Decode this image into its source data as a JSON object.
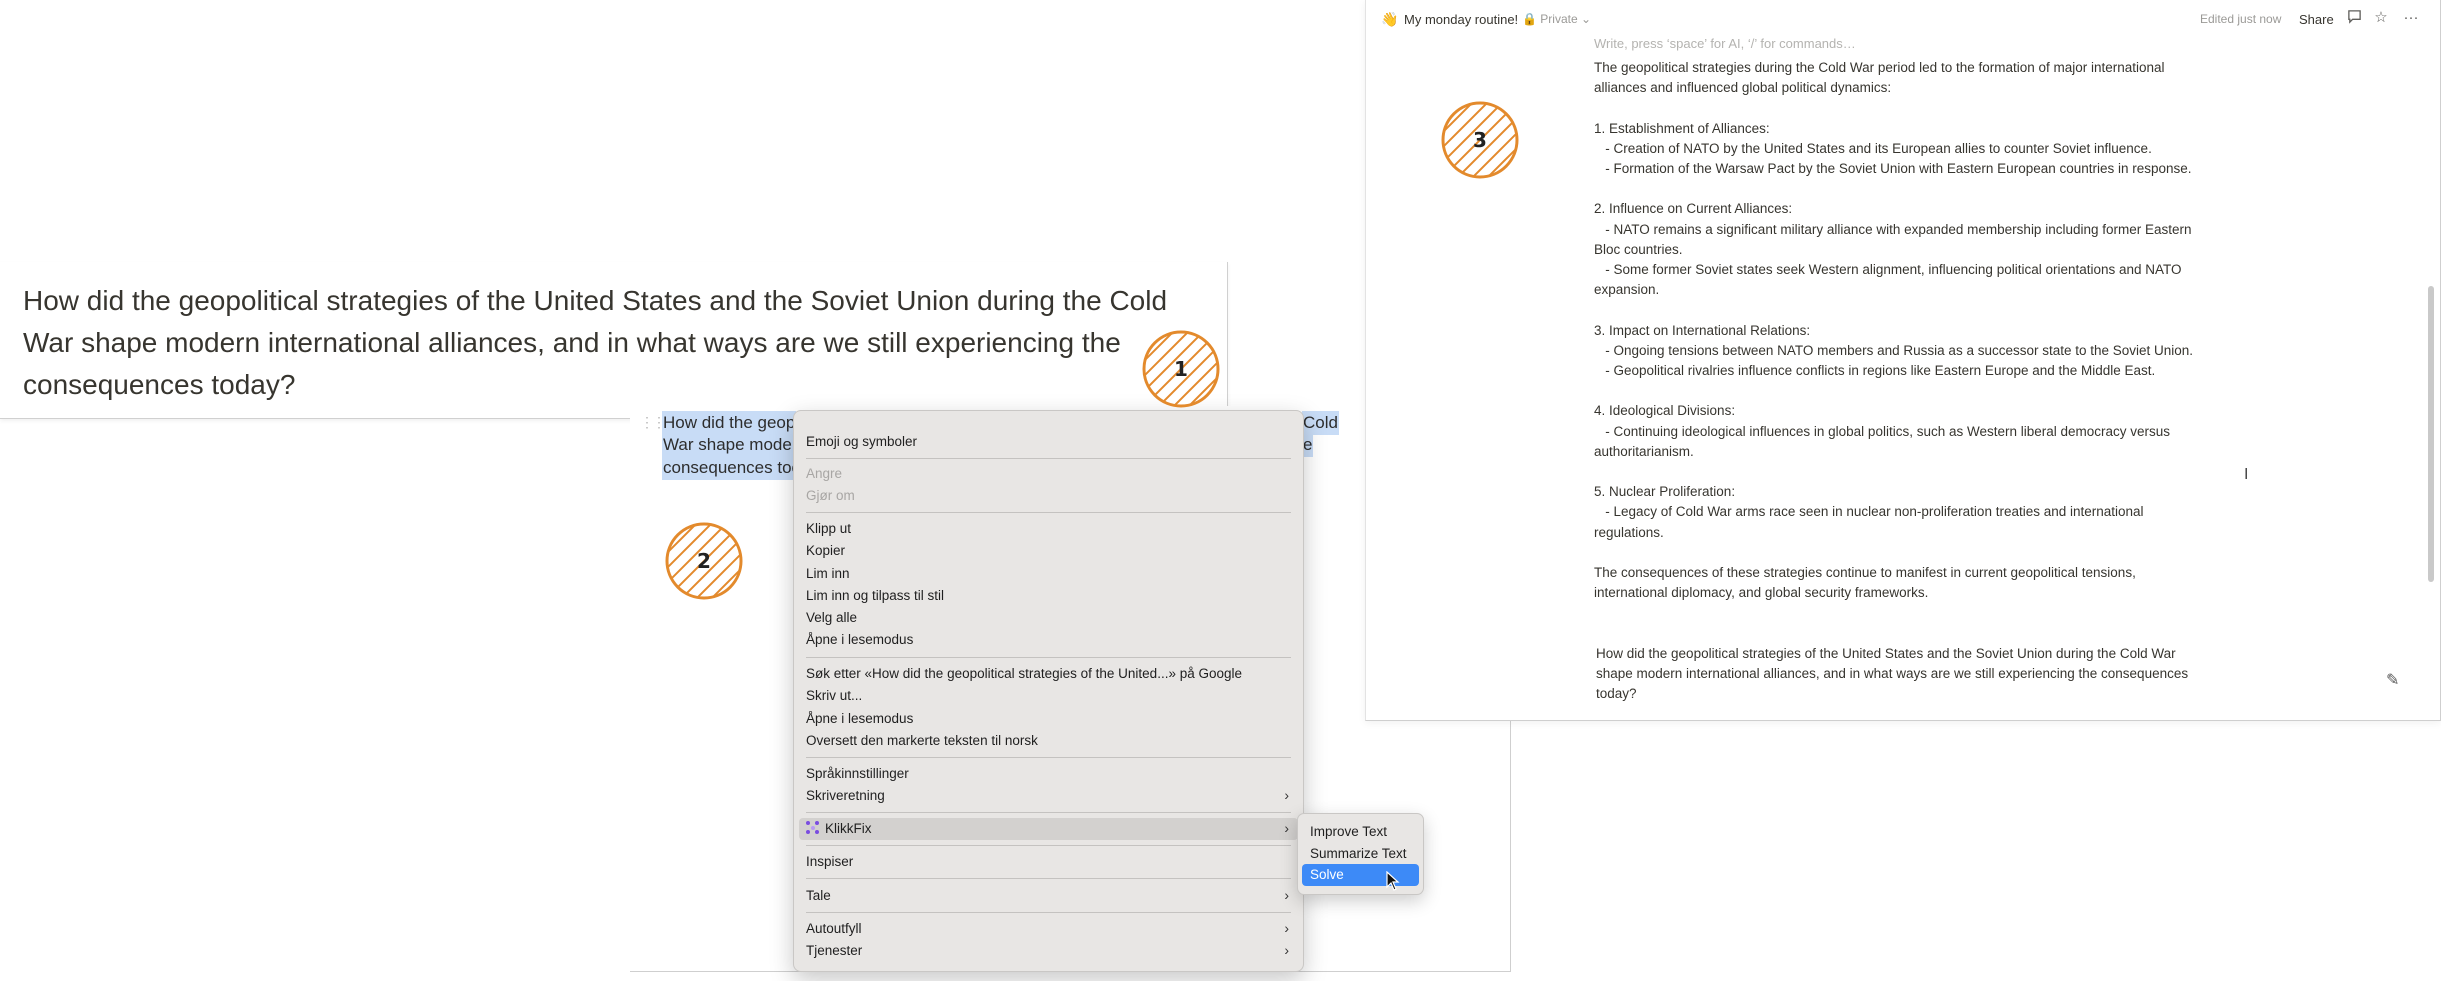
{
  "question_card": {
    "text": "How did the geopolitical strategies of the United States and the Soviet Union during the Cold War shape modern international alliances, and in what ways are we still experiencing the consequences today?"
  },
  "editor": {
    "selected_lines": [
      "How did the geop",
      "War shape moder",
      "consequences toc"
    ],
    "selected_tail": [
      "Cold",
      "e"
    ]
  },
  "context_menu": {
    "items": {
      "emoji": "Emoji og symboler",
      "undo": "Angre",
      "redo": "Gjør om",
      "cut": "Klipp ut",
      "copy": "Kopier",
      "paste": "Lim inn",
      "paste_style": "Lim inn og tilpass til stil",
      "select_all": "Velg alle",
      "reader_mode": "Åpne i lesemodus",
      "search_google": "Søk etter «How did the geopolitical strategies of the United...» på Google",
      "print": "Skriv ut...",
      "reader_mode_2": "Åpne i lesemodus",
      "translate": "Oversett den markerte teksten til norsk",
      "language": "Språkinnstillinger",
      "writing_direction": "Skriveretning",
      "klikkfix": "KlikkFix",
      "inspect": "Inspiser",
      "speech": "Tale",
      "autofill": "Autoutfyll",
      "services": "Tjenester"
    }
  },
  "submenu": {
    "improve": "Improve Text",
    "summarize": "Summarize Text",
    "solve": "Solve"
  },
  "notion": {
    "emoji": "👋",
    "title": "My monday routine!",
    "privacy": "🔒 Private ⌄",
    "edited": "Edited just now",
    "share": "Share",
    "placeholder": "Write, press ‘space’ for AI, ‘/’ for commands…",
    "body": [
      "The geopolitical strategies during the Cold War period led to the formation of major international alliances and influenced global political dynamics:",
      "",
      "1. Establishment of Alliances:",
      "   - Creation of NATO by the United States and its European allies to counter Soviet influence.",
      "   - Formation of the Warsaw Pact by the Soviet Union with Eastern European countries in response.",
      "",
      "2. Influence on Current Alliances:",
      "   - NATO remains a significant military alliance with expanded membership including former Eastern Bloc countries.",
      "   - Some former Soviet states seek Western alignment, influencing political orientations and NATO expansion.",
      "",
      "3. Impact on International Relations:",
      "   - Ongoing tensions between NATO members and Russia as a successor state to the Soviet Union.",
      "   - Geopolitical rivalries influence conflicts in regions like Eastern Europe and the Middle East.",
      "",
      "4. Ideological Divisions:",
      "   - Continuing ideological influences in global politics, such as Western liberal democracy versus authoritarianism.",
      "",
      "5. Nuclear Proliferation:",
      "   - Legacy of Cold War arms race seen in nuclear non-proliferation treaties and international regulations.",
      "",
      "The consequences of these strategies continue to manifest in current geopolitical tensions, international diplomacy, and global security frameworks."
    ],
    "question": "How did the geopolitical strategies of the United States and the Soviet Union during the Cold War shape modern international alliances, and in what ways are we still experiencing the consequences today?"
  },
  "badges": {
    "one": "1",
    "two": "2",
    "three": "3"
  },
  "colors": {
    "badge_stroke": "#e38a2c",
    "highlight": "#3d8af7",
    "selection": "#c8dcf6"
  }
}
